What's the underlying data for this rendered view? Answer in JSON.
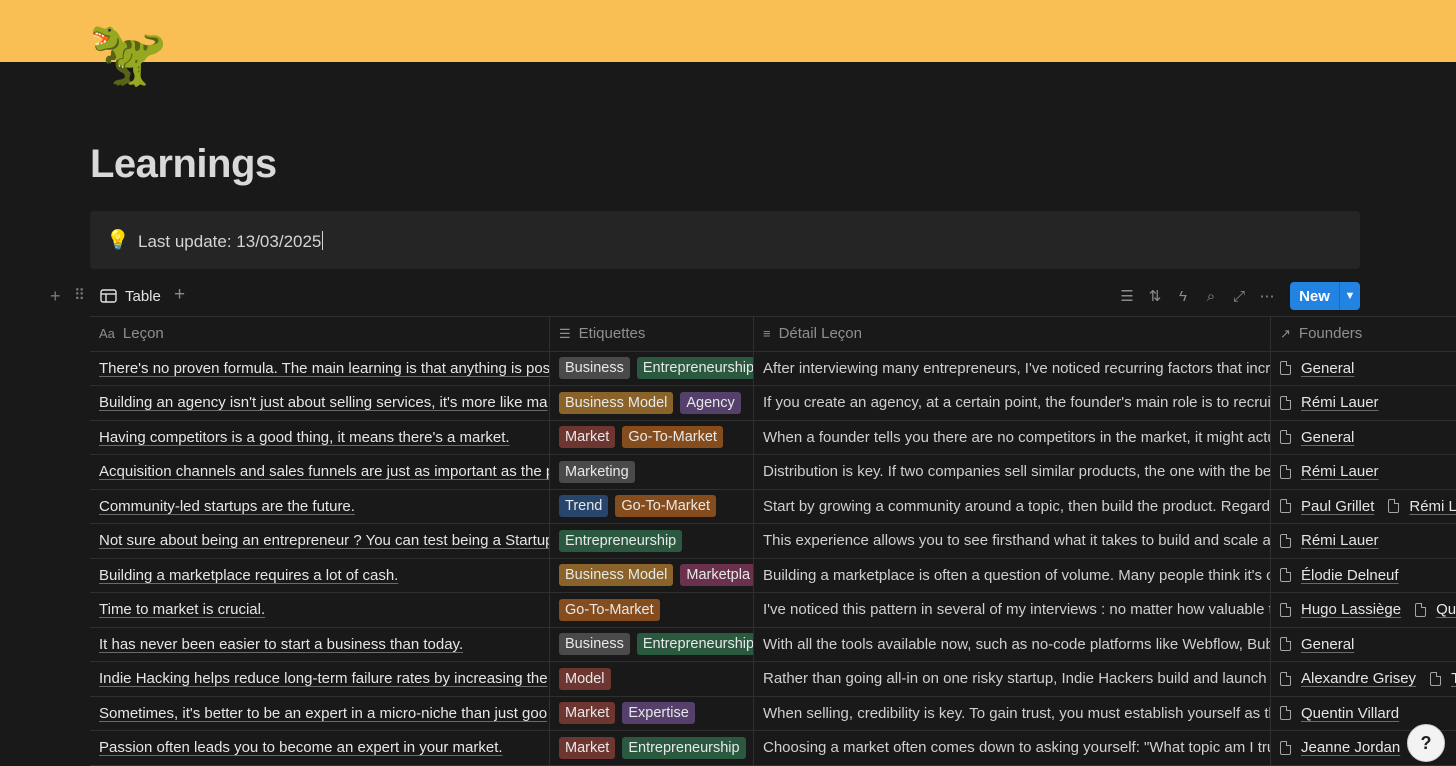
{
  "page": {
    "icon": "🦖",
    "icon_name": "t-rex-icon",
    "title": "Learnings",
    "cover_color": "#f9be54",
    "callout": {
      "icon": "💡",
      "text": "Last update: 13/03/2025"
    }
  },
  "toolbar": {
    "view_label": "Table",
    "new_label": "New",
    "icons": [
      "filter-icon",
      "sort-icon",
      "automation-icon",
      "search-icon",
      "expand-icon",
      "more-icon"
    ]
  },
  "table": {
    "columns": [
      {
        "icon": "Aa",
        "label": "Leçon"
      },
      {
        "icon": "☰",
        "label": "Etiquettes"
      },
      {
        "icon": "≡",
        "label": "Détail Leçon"
      },
      {
        "icon": "↗",
        "label": "Founders"
      }
    ],
    "rows": [
      {
        "lecon": "There's no proven formula. The main learning is that anything is pos",
        "tags": [
          {
            "label": "Business",
            "color": "#4a4a4a"
          },
          {
            "label": "Entrepreneurship",
            "color": "#2b593f"
          }
        ],
        "detail": "After interviewing many entrepreneurs, I've noticed recurring factors that incr",
        "founders": [
          "General"
        ]
      },
      {
        "lecon": "Building an agency isn't just about selling services, it's more like ma",
        "tags": [
          {
            "label": "Business Model",
            "color": "#89632a"
          },
          {
            "label": "Agency",
            "color": "#553f6b"
          }
        ],
        "detail": "If you create an agency, at a certain point, the founder's main role is to recruit",
        "founders": [
          "Rémi Lauer"
        ]
      },
      {
        "lecon": "Having competitors is a good thing, it means there's a market.",
        "tags": [
          {
            "label": "Market",
            "color": "#6e3630"
          },
          {
            "label": "Go-To-Market",
            "color": "#854c1d"
          }
        ],
        "detail": "When a founder tells you there are no competitors in the market, it might actu",
        "founders": [
          "General"
        ]
      },
      {
        "lecon": "Acquisition channels and sales funnels are just as important as the p",
        "tags": [
          {
            "label": "Marketing",
            "color": "#4a4a4a"
          }
        ],
        "detail": "Distribution is key. If two companies sell similar products, the one with the bes",
        "founders": [
          "Rémi Lauer"
        ]
      },
      {
        "lecon": "Community-led startups are the future.",
        "tags": [
          {
            "label": "Trend",
            "color": "#28456c"
          },
          {
            "label": "Go-To-Market",
            "color": "#854c1d"
          }
        ],
        "detail": "Start by growing a community around a topic, then build the product. Regardle",
        "founders": [
          "Paul Grillet",
          "Rémi La"
        ]
      },
      {
        "lecon": "Not sure about being an entrepreneur ? You can test being a Startup",
        "tags": [
          {
            "label": "Entrepreneurship",
            "color": "#2b593f"
          }
        ],
        "detail": "This experience allows you to see firsthand what it takes to build and scale a b",
        "founders": [
          "Rémi Lauer"
        ]
      },
      {
        "lecon": "Building a marketplace requires a lot of cash.",
        "tags": [
          {
            "label": "Business Model",
            "color": "#89632a"
          },
          {
            "label": "Marketpla",
            "color": "#69314c"
          }
        ],
        "detail": "Building a marketplace is often a question of volume. Many people think it's co",
        "founders": [
          "Élodie Delneuf"
        ]
      },
      {
        "lecon": "Time to market is crucial.",
        "tags": [
          {
            "label": "Go-To-Market",
            "color": "#854c1d"
          }
        ],
        "detail": "I've noticed this pattern in several of my interviews : no matter how valuable th",
        "founders": [
          "Hugo Lassiège",
          "Qu"
        ]
      },
      {
        "lecon": "It has never been easier to start a business than today.",
        "tags": [
          {
            "label": "Business",
            "color": "#4a4a4a"
          },
          {
            "label": "Entrepreneurship",
            "color": "#2b593f"
          }
        ],
        "detail": "With all the tools available now, such as no-code platforms like Webflow, Bubb",
        "founders": [
          "General"
        ]
      },
      {
        "lecon": "Indie Hacking helps reduce long-term failure rates by increasing the",
        "tags": [
          {
            "label": "Model",
            "color": "#6e3630"
          }
        ],
        "detail": "Rather than going all-in on one risky startup, Indie Hackers build and launch m",
        "founders": [
          "Alexandre Grisey",
          "T"
        ]
      },
      {
        "lecon": "Sometimes, it's better to be an expert in a micro-niche than just goo",
        "tags": [
          {
            "label": "Market",
            "color": "#6e3630"
          },
          {
            "label": "Expertise",
            "color": "#553f6b"
          }
        ],
        "detail": "When selling, credibility is key. To gain trust, you must establish yourself as th",
        "founders": [
          "Quentin Villard"
        ]
      },
      {
        "lecon": "Passion often leads you to become an expert in your market.",
        "tags": [
          {
            "label": "Market",
            "color": "#6e3630"
          },
          {
            "label": "Entrepreneurship",
            "color": "#2b593f"
          }
        ],
        "detail": "Choosing a market often comes down to asking yourself: \"What topic am I tru",
        "founders": [
          "Jeanne Jordan"
        ]
      }
    ]
  },
  "help_button": {
    "label": "?"
  }
}
